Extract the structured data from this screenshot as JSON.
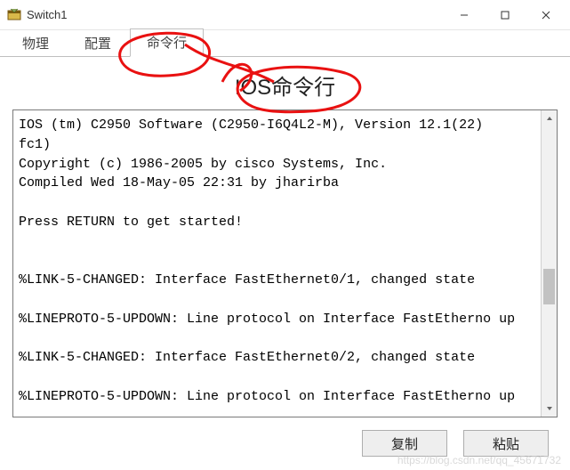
{
  "window": {
    "title": "Switch1"
  },
  "tabs": {
    "physical": "物理",
    "config": "配置",
    "cli": "命令行"
  },
  "heading": "IOS命令行",
  "terminal_text": "IOS (tm) C2950 Software (C2950-I6Q4L2-M), Version 12.1(22)\nfc1)\nCopyright (c) 1986-2005 by cisco Systems, Inc.\nCompiled Wed 18-May-05 22:31 by jharirba\n\nPress RETURN to get started!\n\n\n%LINK-5-CHANGED: Interface FastEthernet0/1, changed state \n\n%LINEPROTO-5-UPDOWN: Line protocol on Interface FastEtherno up\n\n%LINK-5-CHANGED: Interface FastEthernet0/2, changed state \n\n%LINEPROTO-5-UPDOWN: Line protocol on Interface FastEtherno up\n",
  "buttons": {
    "copy": "复制",
    "paste": "粘贴"
  },
  "watermark": "https://blog.csdn.net/qq_45671732"
}
